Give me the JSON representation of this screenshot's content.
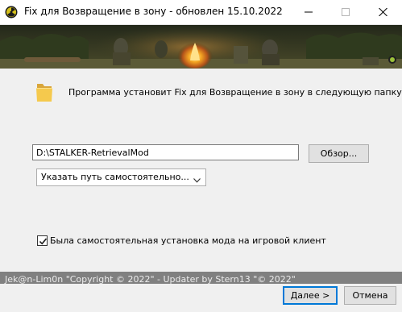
{
  "window": {
    "title": "Fix для Возвращение в зону - обновлен 15.10.2022"
  },
  "main": {
    "info_text": "Программа установит Fix для Возвращение в зону в следующую папку.",
    "path_value": "D:\\STALKER-RetrievalMod",
    "browse_label": "Обзор...",
    "select_value": "Указать путь самостоятельно...",
    "checkbox_label": "Была самостоятельная установка мода на игровой клиент",
    "checkbox_checked": true
  },
  "footer": {
    "credits": "Jek@n-Lim0n \"Copyright © 2022\" - Updater by Stern13 \"© 2022\"",
    "next_label": "Далее >",
    "cancel_label": "Отмена"
  },
  "colors": {
    "accent": "#0078d7",
    "folder": "#e8b64c"
  }
}
